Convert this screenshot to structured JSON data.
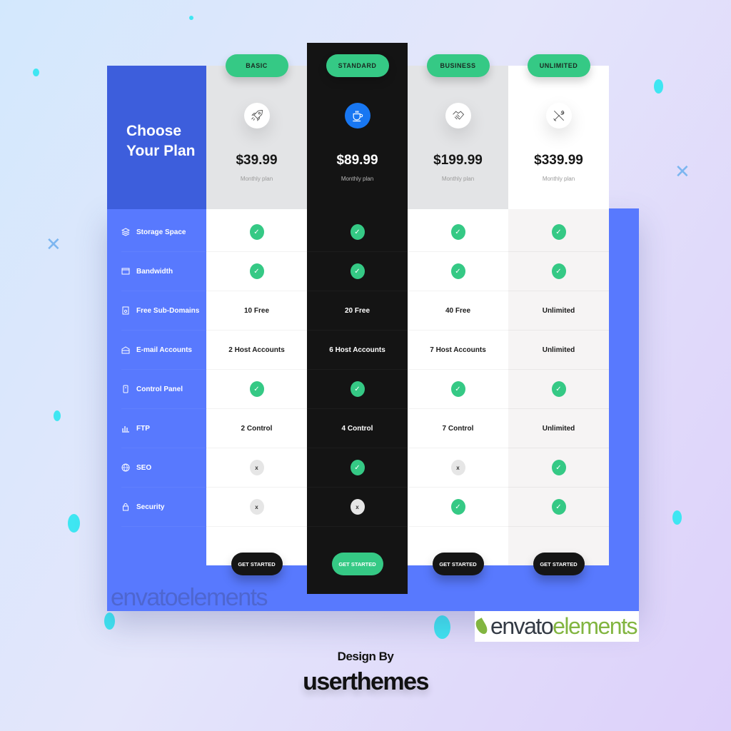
{
  "header": {
    "title": "Choose Your Plan"
  },
  "features": [
    {
      "label": "Storage Space",
      "icon": "layers-icon"
    },
    {
      "label": "Bandwidth",
      "icon": "window-icon"
    },
    {
      "label": "Free Sub-Domains",
      "icon": "domain-icon"
    },
    {
      "label": "E-mail Accounts",
      "icon": "mailbox-icon"
    },
    {
      "label": "Control Panel",
      "icon": "phone-panel-icon"
    },
    {
      "label": "FTP",
      "icon": "chart-bars-icon"
    },
    {
      "label": "SEO",
      "icon": "globe-icon"
    },
    {
      "label": "Security",
      "icon": "lock-icon"
    }
  ],
  "plans": [
    {
      "name": "BASIC",
      "icon": "rocket-icon",
      "price": "$39.99",
      "period": "Monthly plan",
      "values": [
        "check",
        "check",
        "10 Free",
        "2 Host Accounts",
        "check",
        "2 Control",
        "cross",
        "cross"
      ],
      "cta": "GET STARTED"
    },
    {
      "name": "STANDARD",
      "icon": "coffee-cup-icon",
      "price": "$89.99",
      "period": "Monthly plan",
      "values": [
        "check",
        "check",
        "20 Free",
        "6 Host Accounts",
        "check",
        "4 Control",
        "check",
        "cross"
      ],
      "cta": "GET STARTED",
      "featured": true
    },
    {
      "name": "BUSINESS",
      "icon": "handshake-icon",
      "price": "$199.99",
      "period": "Monthly plan",
      "values": [
        "check",
        "check",
        "40 Free",
        "7 Host Accounts",
        "check",
        "7 Control",
        "cross",
        "check"
      ],
      "cta": "GET STARTED"
    },
    {
      "name": "UNLIMITED",
      "icon": "tools-icon",
      "price": "$339.99",
      "period": "Monthly plan",
      "values": [
        "check",
        "check",
        "Unlimited",
        "Unlimited",
        "check",
        "Unlimited",
        "check",
        "check"
      ],
      "cta": "GET STARTED"
    }
  ],
  "symbols": {
    "check": "✓",
    "cross": "x"
  },
  "watermark": {
    "part1": "envato",
    "part2": "elements"
  },
  "footer": {
    "design_by": "Design By",
    "brand": "userthemes"
  },
  "colors": {
    "accent_green": "#35c985",
    "primary_blue": "#5879fe",
    "dark_blue": "#3d5edc",
    "featured_dark": "#141414",
    "icon_blue": "#1877f2"
  }
}
